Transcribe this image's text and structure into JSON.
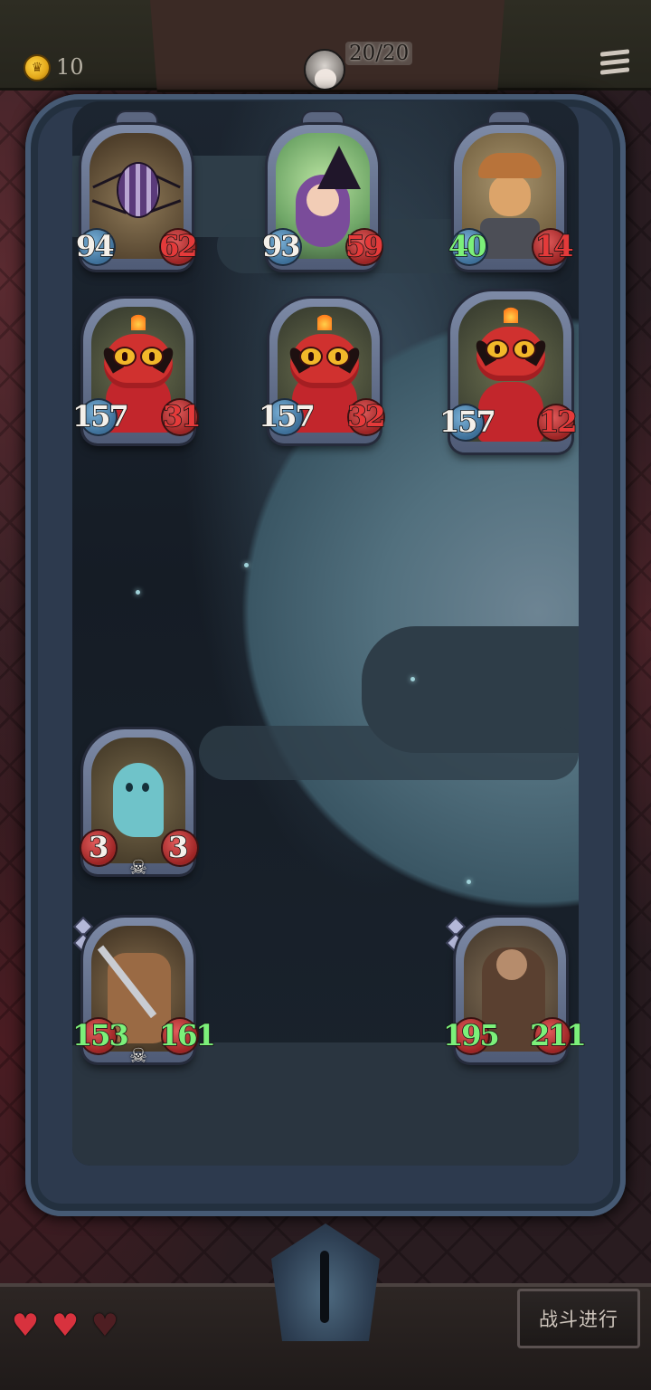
{
  "header": {
    "coins": "10",
    "hp_counter": "20/20"
  },
  "enemy_row1": [
    {
      "name": "spider",
      "hp": "94",
      "atk": "62",
      "hp_color": "white",
      "atk_color": "red"
    },
    {
      "name": "witch",
      "hp": "93",
      "atk": "59",
      "hp_color": "white",
      "atk_color": "red"
    },
    {
      "name": "rogue",
      "hp": "40",
      "atk": "14",
      "hp_color": "green",
      "atk_color": "red"
    }
  ],
  "enemy_row2": [
    {
      "name": "imp",
      "hp": "157",
      "atk": "31"
    },
    {
      "name": "imp",
      "hp": "157",
      "atk": "32"
    },
    {
      "name": "imp",
      "hp": "157",
      "atk": "12"
    }
  ],
  "player_ghost": {
    "name": "ghost",
    "hp": "3",
    "atk": "3"
  },
  "player_row": [
    {
      "name": "warrior",
      "hp": "153",
      "atk": "161"
    },
    {
      "name": "brute",
      "hp": "195",
      "atk": "211"
    }
  ],
  "lives": {
    "total": 3,
    "remaining": 2
  },
  "battle_button": "战斗进行",
  "colors": {
    "stat_white": "#f4f0ea",
    "stat_red": "#e43a3a",
    "stat_green": "#7cf07a",
    "heart": "#d8323e"
  }
}
